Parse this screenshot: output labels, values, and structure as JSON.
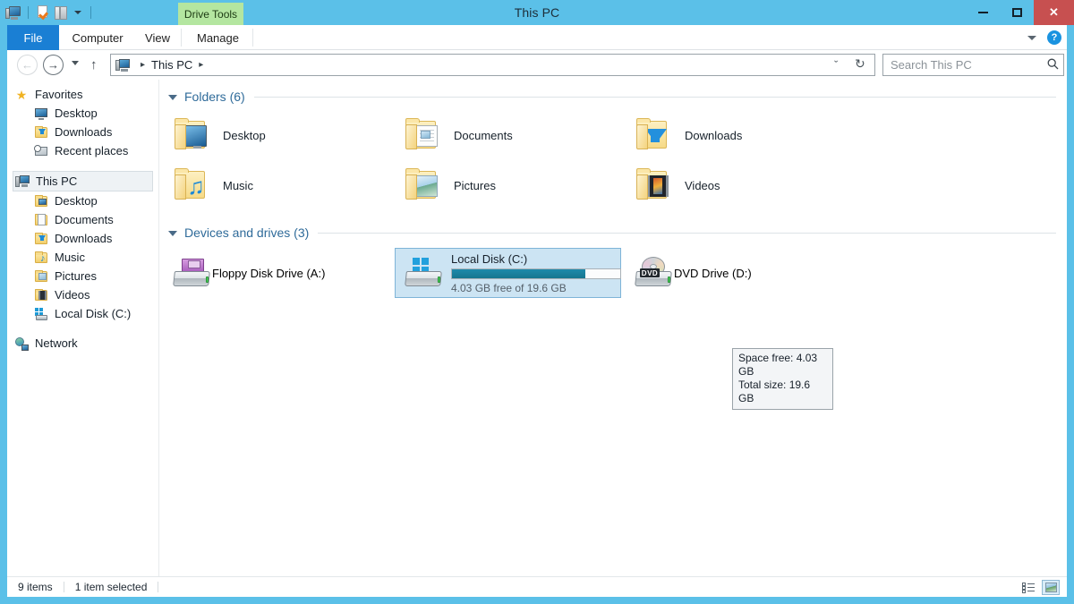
{
  "window": {
    "title": "This PC",
    "controls": {
      "minimize": "–",
      "maximize": "□",
      "close": "✕"
    },
    "quick_access": [
      {
        "name": "this-pc-icon",
        "label": "This PC"
      },
      {
        "name": "new-folder-icon",
        "label": "New folder"
      },
      {
        "name": "properties-icon",
        "label": "Properties"
      },
      {
        "name": "customize-caret",
        "label": "Customize Quick Access Toolbar"
      }
    ]
  },
  "contextual_tab": {
    "label": "Drive Tools",
    "color": "#b4e6a0"
  },
  "ribbon": {
    "tabs": [
      {
        "label": "File",
        "active": true
      },
      {
        "label": "Computer",
        "active": false
      },
      {
        "label": "View",
        "active": false
      },
      {
        "label": "Manage",
        "active": false
      }
    ],
    "expand_label": "ˇ",
    "help_label": "?"
  },
  "addressbar": {
    "back": "←",
    "forward": "→",
    "recent": "recent-locations",
    "up": "↑",
    "breadcrumb": {
      "root_icon": "this-pc-icon",
      "path": [
        "This PC"
      ],
      "separator": "▸"
    },
    "history_chevron": "ˇ",
    "refresh": "↻"
  },
  "search": {
    "placeholder": "Search This PC",
    "icon": "🔍"
  },
  "navpane": {
    "groups": [
      {
        "name": "favorites",
        "header": {
          "label": "Favorites",
          "icon": "star-icon"
        },
        "items": [
          {
            "label": "Desktop",
            "icon": "desktop-icon"
          },
          {
            "label": "Downloads",
            "icon": "downloads-folder-icon"
          },
          {
            "label": "Recent places",
            "icon": "recent-places-icon"
          }
        ]
      },
      {
        "name": "this-pc",
        "header": {
          "label": "This PC",
          "icon": "this-pc-icon",
          "selected": true
        },
        "items": [
          {
            "label": "Desktop",
            "icon": "desktop-folder-icon"
          },
          {
            "label": "Documents",
            "icon": "documents-folder-icon"
          },
          {
            "label": "Downloads",
            "icon": "downloads-folder-icon"
          },
          {
            "label": "Music",
            "icon": "music-folder-icon"
          },
          {
            "label": "Pictures",
            "icon": "pictures-folder-icon"
          },
          {
            "label": "Videos",
            "icon": "videos-folder-icon"
          },
          {
            "label": "Local Disk (C:)",
            "icon": "local-disk-icon"
          }
        ]
      },
      {
        "name": "network",
        "header": {
          "label": "Network",
          "icon": "network-icon"
        },
        "items": []
      }
    ]
  },
  "main": {
    "groups": [
      {
        "name": "folders",
        "title": "Folders (6)",
        "items": [
          {
            "label": "Desktop",
            "icon": "desktop-folder-icon"
          },
          {
            "label": "Documents",
            "icon": "documents-folder-icon"
          },
          {
            "label": "Downloads",
            "icon": "downloads-folder-icon"
          },
          {
            "label": "Music",
            "icon": "music-folder-icon"
          },
          {
            "label": "Pictures",
            "icon": "pictures-folder-icon"
          },
          {
            "label": "Videos",
            "icon": "videos-folder-icon"
          }
        ]
      },
      {
        "name": "devices-and-drives",
        "title": "Devices and drives (3)",
        "items": [
          {
            "label": "Floppy Disk Drive (A:)",
            "icon": "floppy-drive-icon",
            "selected": false
          },
          {
            "label": "Local Disk (C:)",
            "icon": "local-disk-icon",
            "selected": true,
            "capacity_text": "4.03 GB free of 19.6 GB",
            "used_percent": 79
          },
          {
            "label": "DVD Drive (D:)",
            "icon": "dvd-drive-icon",
            "selected": false
          }
        ]
      }
    ]
  },
  "tooltip": {
    "line1": "Space free: 4.03 GB",
    "line2": "Total size: 19.6 GB"
  },
  "statusbar": {
    "item_count": "9 items",
    "selection": "1 item selected",
    "views": [
      {
        "name": "details-view",
        "active": false
      },
      {
        "name": "large-icons-view",
        "active": true
      }
    ]
  },
  "colors": {
    "chrome": "#5bc0e8",
    "file_tab": "#1a7fd4",
    "contextual_tab": "#b4e6a0",
    "close_button": "#c75050",
    "selection": "#cce4f3",
    "gauge_fill": "#1a7f9c",
    "group_title": "#2f6b9a"
  }
}
